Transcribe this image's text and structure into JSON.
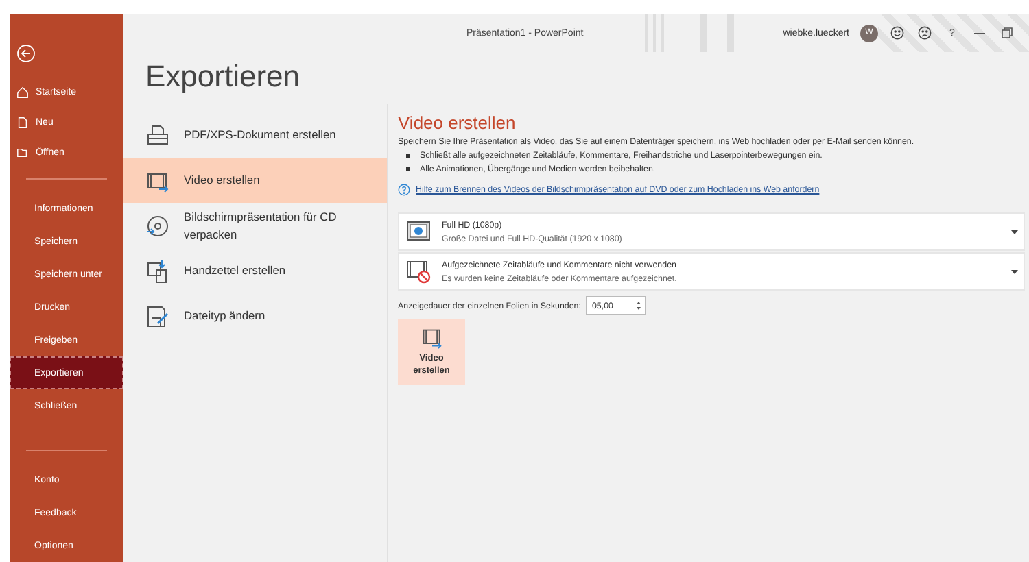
{
  "window": {
    "title": "Präsentation1  -  PowerPoint",
    "user": "wiebke.lueckert",
    "avatar": "W",
    "help": "?"
  },
  "sidebar": {
    "sections": [
      [
        {
          "label": "Startseite",
          "kind": "home",
          "selected": false
        },
        {
          "label": "Neu",
          "kind": "new",
          "selected": false
        },
        {
          "label": "Öffnen",
          "kind": "open",
          "selected": false
        }
      ],
      [
        {
          "label": "Informationen",
          "selected": false
        },
        {
          "label": "Speichern",
          "selected": false
        },
        {
          "label": "Speichern unter",
          "selected": false
        },
        {
          "label": "Drucken",
          "selected": false
        },
        {
          "label": "Freigeben",
          "selected": false
        },
        {
          "label": "Exportieren",
          "selected": true
        },
        {
          "label": "Schließen",
          "selected": false
        }
      ],
      [
        {
          "label": "Konto",
          "selected": false
        },
        {
          "label": "Feedback",
          "selected": false
        },
        {
          "label": "Optionen",
          "selected": false
        }
      ]
    ]
  },
  "page_title": "Exportieren",
  "export_options": [
    {
      "label": "PDF/XPS-Dokument erstellen",
      "kind": "pdf",
      "selected": false
    },
    {
      "label": "Video erstellen",
      "kind": "video",
      "selected": true
    },
    {
      "label": "Bildschirmpräsentation für CD verpacken",
      "kind": "cd",
      "selected": false
    },
    {
      "label": "Handzettel erstellen",
      "kind": "handout",
      "selected": false
    },
    {
      "label": "Dateityp ändern",
      "kind": "filetype",
      "selected": false
    }
  ],
  "detail": {
    "title": "Video erstellen",
    "description": "Speichern Sie Ihre Präsentation als Video, das Sie auf einem Datenträger speichern, ins Web hochladen oder per E-Mail senden können.",
    "bullets": [
      "Schließt alle aufgezeichneten Zeitabläufe, Kommentare, Freihandstriche und Laserpointerbewegungen ein.",
      "Alle Animationen, Übergänge und Medien werden beibehalten."
    ],
    "help_link": "Hilfe zum Brennen des Videos der Bildschirmpräsentation auf DVD oder zum Hochladen ins Web anfordern",
    "dropdowns": [
      {
        "kind": "quality",
        "title": "Full HD (1080p)",
        "subtitle": "Große Datei und Full HD-Qualität (1920 x 1080)"
      },
      {
        "kind": "timings",
        "title": "Aufgezeichnete Zeitabläufe und Kommentare nicht verwenden",
        "subtitle": "Es wurden keine Zeitabläufe oder Kommentare aufgezeichnet."
      }
    ],
    "duration_label": "Anzeigedauer der einzelnen Folien in Sekunden:",
    "duration_value": "05,00",
    "create_button": "Video erstellen"
  }
}
